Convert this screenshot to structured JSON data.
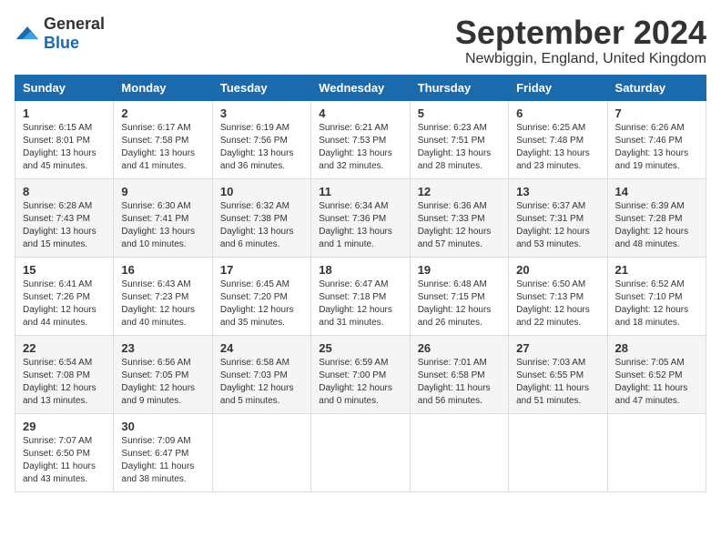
{
  "logo": {
    "general": "General",
    "blue": "Blue"
  },
  "title": "September 2024",
  "location": "Newbiggin, England, United Kingdom",
  "days_of_week": [
    "Sunday",
    "Monday",
    "Tuesday",
    "Wednesday",
    "Thursday",
    "Friday",
    "Saturday"
  ],
  "weeks": [
    [
      {
        "day": "1",
        "sunrise": "6:15 AM",
        "sunset": "8:01 PM",
        "daylight": "13 hours and 45 minutes."
      },
      {
        "day": "2",
        "sunrise": "6:17 AM",
        "sunset": "7:58 PM",
        "daylight": "13 hours and 41 minutes."
      },
      {
        "day": "3",
        "sunrise": "6:19 AM",
        "sunset": "7:56 PM",
        "daylight": "13 hours and 36 minutes."
      },
      {
        "day": "4",
        "sunrise": "6:21 AM",
        "sunset": "7:53 PM",
        "daylight": "13 hours and 32 minutes."
      },
      {
        "day": "5",
        "sunrise": "6:23 AM",
        "sunset": "7:51 PM",
        "daylight": "13 hours and 28 minutes."
      },
      {
        "day": "6",
        "sunrise": "6:25 AM",
        "sunset": "7:48 PM",
        "daylight": "13 hours and 23 minutes."
      },
      {
        "day": "7",
        "sunrise": "6:26 AM",
        "sunset": "7:46 PM",
        "daylight": "13 hours and 19 minutes."
      }
    ],
    [
      {
        "day": "8",
        "sunrise": "6:28 AM",
        "sunset": "7:43 PM",
        "daylight": "13 hours and 15 minutes."
      },
      {
        "day": "9",
        "sunrise": "6:30 AM",
        "sunset": "7:41 PM",
        "daylight": "13 hours and 10 minutes."
      },
      {
        "day": "10",
        "sunrise": "6:32 AM",
        "sunset": "7:38 PM",
        "daylight": "13 hours and 6 minutes."
      },
      {
        "day": "11",
        "sunrise": "6:34 AM",
        "sunset": "7:36 PM",
        "daylight": "13 hours and 1 minute."
      },
      {
        "day": "12",
        "sunrise": "6:36 AM",
        "sunset": "7:33 PM",
        "daylight": "12 hours and 57 minutes."
      },
      {
        "day": "13",
        "sunrise": "6:37 AM",
        "sunset": "7:31 PM",
        "daylight": "12 hours and 53 minutes."
      },
      {
        "day": "14",
        "sunrise": "6:39 AM",
        "sunset": "7:28 PM",
        "daylight": "12 hours and 48 minutes."
      }
    ],
    [
      {
        "day": "15",
        "sunrise": "6:41 AM",
        "sunset": "7:26 PM",
        "daylight": "12 hours and 44 minutes."
      },
      {
        "day": "16",
        "sunrise": "6:43 AM",
        "sunset": "7:23 PM",
        "daylight": "12 hours and 40 minutes."
      },
      {
        "day": "17",
        "sunrise": "6:45 AM",
        "sunset": "7:20 PM",
        "daylight": "12 hours and 35 minutes."
      },
      {
        "day": "18",
        "sunrise": "6:47 AM",
        "sunset": "7:18 PM",
        "daylight": "12 hours and 31 minutes."
      },
      {
        "day": "19",
        "sunrise": "6:48 AM",
        "sunset": "7:15 PM",
        "daylight": "12 hours and 26 minutes."
      },
      {
        "day": "20",
        "sunrise": "6:50 AM",
        "sunset": "7:13 PM",
        "daylight": "12 hours and 22 minutes."
      },
      {
        "day": "21",
        "sunrise": "6:52 AM",
        "sunset": "7:10 PM",
        "daylight": "12 hours and 18 minutes."
      }
    ],
    [
      {
        "day": "22",
        "sunrise": "6:54 AM",
        "sunset": "7:08 PM",
        "daylight": "12 hours and 13 minutes."
      },
      {
        "day": "23",
        "sunrise": "6:56 AM",
        "sunset": "7:05 PM",
        "daylight": "12 hours and 9 minutes."
      },
      {
        "day": "24",
        "sunrise": "6:58 AM",
        "sunset": "7:03 PM",
        "daylight": "12 hours and 5 minutes."
      },
      {
        "day": "25",
        "sunrise": "6:59 AM",
        "sunset": "7:00 PM",
        "daylight": "12 hours and 0 minutes."
      },
      {
        "day": "26",
        "sunrise": "7:01 AM",
        "sunset": "6:58 PM",
        "daylight": "11 hours and 56 minutes."
      },
      {
        "day": "27",
        "sunrise": "7:03 AM",
        "sunset": "6:55 PM",
        "daylight": "11 hours and 51 minutes."
      },
      {
        "day": "28",
        "sunrise": "7:05 AM",
        "sunset": "6:52 PM",
        "daylight": "11 hours and 47 minutes."
      }
    ],
    [
      {
        "day": "29",
        "sunrise": "7:07 AM",
        "sunset": "6:50 PM",
        "daylight": "11 hours and 43 minutes."
      },
      {
        "day": "30",
        "sunrise": "7:09 AM",
        "sunset": "6:47 PM",
        "daylight": "11 hours and 38 minutes."
      },
      null,
      null,
      null,
      null,
      null
    ]
  ],
  "labels": {
    "sunrise": "Sunrise:",
    "sunset": "Sunset:",
    "daylight": "Daylight:"
  }
}
